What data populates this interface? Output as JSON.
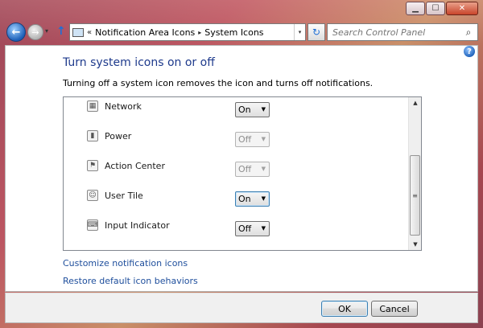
{
  "window": {
    "controls": {
      "minimize_icon": "▁",
      "maximize_icon": "☐",
      "close_icon": "✕"
    }
  },
  "nav": {
    "back_icon": "←",
    "forward_icon": "→",
    "history_drop_icon": "▾",
    "up_icon": "↑",
    "address_chevrons": "«",
    "breadcrumbs": [
      "Notification Area Icons",
      "System Icons"
    ],
    "breadcrumb_sep": "▸",
    "address_drop_icon": "▾",
    "refresh_icon": "↻",
    "search_placeholder": "Search Control Panel",
    "search_icon": "⌕"
  },
  "main": {
    "help_icon": "?",
    "heading": "Turn system icons on or off",
    "description": "Turning off a system icon removes the icon and turns off notifications.",
    "icons": [
      {
        "label": "Network",
        "icon": "network-icon",
        "glyph": "▦",
        "value": "On",
        "enabled": true
      },
      {
        "label": "Power",
        "icon": "power-icon",
        "glyph": "▮",
        "value": "Off",
        "enabled": false
      },
      {
        "label": "Action Center",
        "icon": "flag-icon",
        "glyph": "⚑",
        "value": "Off",
        "enabled": false
      },
      {
        "label": "User Tile",
        "icon": "user-icon",
        "glyph": "☺",
        "value": "On",
        "enabled": true
      },
      {
        "label": "Input Indicator",
        "icon": "keyboard-icon",
        "glyph": "⌨",
        "value": "Off",
        "enabled": true
      }
    ],
    "dropdown_arrow": "▼",
    "scroll_up": "▲",
    "scroll_down": "▼",
    "scroll_grip": "≡",
    "links": {
      "customize": "Customize notification icons",
      "restore": "Restore default icon behaviors"
    }
  },
  "footer": {
    "ok_label": "OK",
    "cancel_label": "Cancel"
  }
}
